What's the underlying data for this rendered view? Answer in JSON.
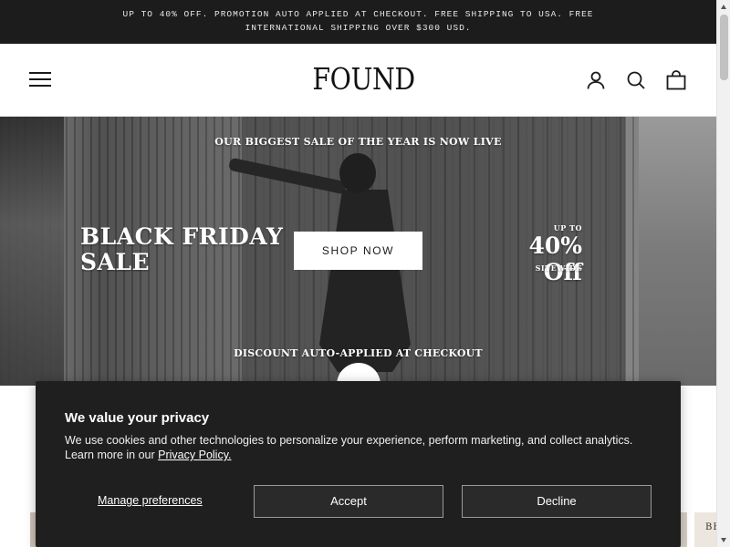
{
  "announcement": {
    "line1": "UP TO 40% OFF. PROMOTION AUTO APPLIED AT CHECKOUT. FREE SHIPPING TO USA. FREE",
    "line2": "INTERNATIONAL SHIPPING OVER $300 USD."
  },
  "header": {
    "logo": "FOUND",
    "icons": [
      "menu-icon",
      "account-icon",
      "search-icon",
      "cart-icon"
    ]
  },
  "hero": {
    "top_text": "OUR BIGGEST SALE OF THE YEAR IS NOW LIVE",
    "headline_line1": "BLACK FRIDAY",
    "headline_line2": "SALE",
    "cta": "SHOP NOW",
    "up_to": "UP TO",
    "percent": "40% Off",
    "sitewide": "SITEWIDE",
    "bottom_text": "DISCOUNT AUTO-APPLIED AT CHECKOUT"
  },
  "peek": {
    "right_text": "BE"
  },
  "cookie_banner": {
    "title": "We value your privacy",
    "body": "We use cookies and other technologies to personalize your experience, perform marketing, and collect analytics. Learn more in our",
    "link": "Privacy Policy.",
    "manage": "Manage preferences",
    "accept": "Accept",
    "decline": "Decline"
  },
  "colors": {
    "announcement_bg": "#1c1c1c",
    "banner_bg": "#1f1f1f",
    "button_border": "#9a9a9a"
  }
}
